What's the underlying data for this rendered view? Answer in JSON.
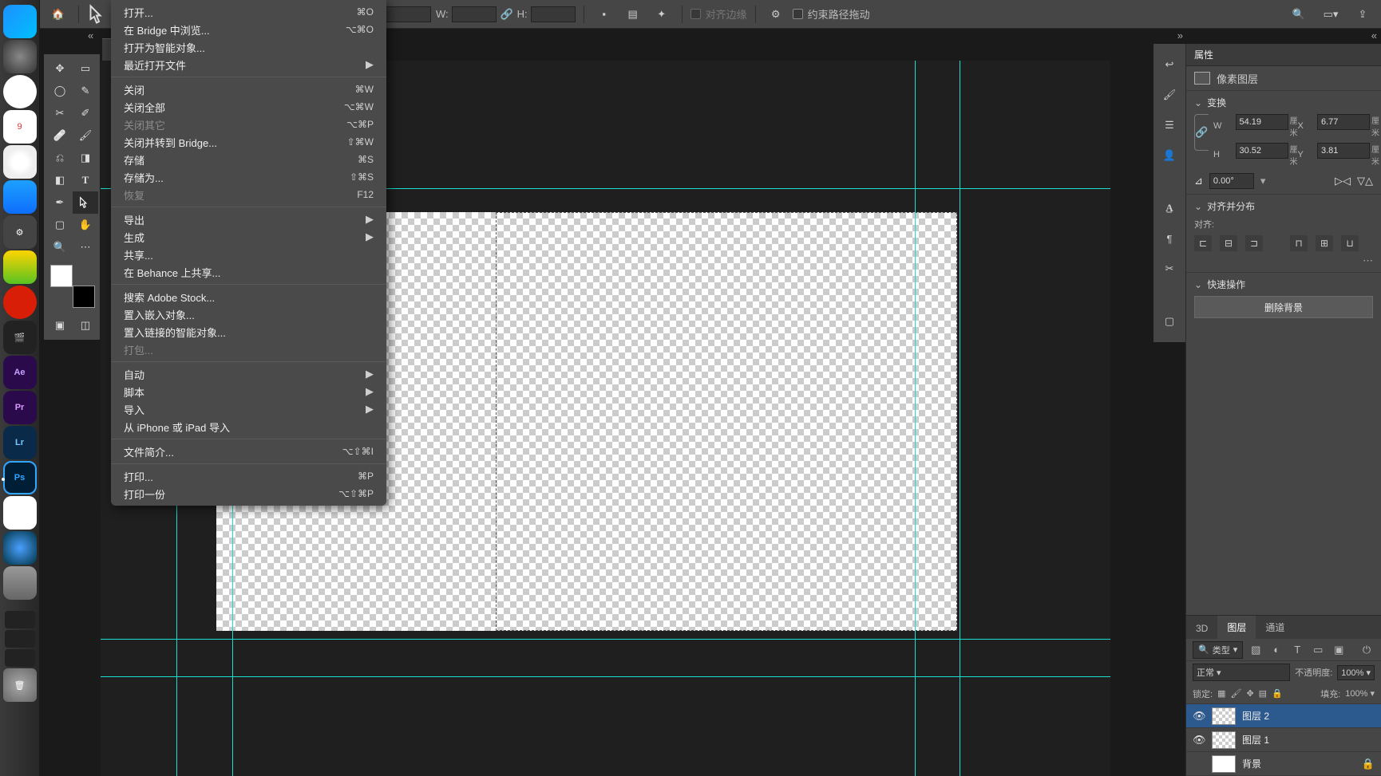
{
  "dock": {
    "items": [
      "finder",
      "launchpad",
      "safari",
      "cal",
      "photos",
      "appstore",
      "settings",
      "music",
      "netease",
      "fcp",
      "ae",
      "pr",
      "lr",
      "ps",
      "youku",
      "qt",
      "cam"
    ],
    "labels": {
      "ae": "Ae",
      "pr": "Pr",
      "lr": "Lr",
      "ps": "Ps",
      "cal": "9"
    }
  },
  "optbar": {
    "w_label": "W:",
    "h_label": "H:",
    "align_edges": "对齐边缘",
    "constrain": "约束路径拖动",
    "search": "🔍"
  },
  "tab_close": "×",
  "props": {
    "panel_title": "属性",
    "layer_type": "像素图层",
    "transform_title": "变换",
    "W": "54.19",
    "W_unit": "厘米",
    "X": "6.77",
    "X_unit": "厘米",
    "H": "30.52",
    "H_unit": "厘米",
    "Y": "3.81",
    "Y_unit": "厘米",
    "angle": "0.00°",
    "align_title": "对齐并分布",
    "align_label": "对齐:",
    "quick_title": "快速操作",
    "remove_bg": "删除背景"
  },
  "layers_panel": {
    "tabs": [
      "3D",
      "图层",
      "通道"
    ],
    "filter_label": "类型",
    "blend": "正常",
    "opacity_label": "不透明度:",
    "opacity": "100%",
    "lock_label": "锁定:",
    "fill_label": "填充:",
    "fill": "100%",
    "layers": [
      {
        "name": "图层 2",
        "visible": true,
        "selected": true,
        "locked": false,
        "thumb": "trans"
      },
      {
        "name": "图层 1",
        "visible": true,
        "selected": false,
        "locked": false,
        "thumb": "trans"
      },
      {
        "name": "背景",
        "visible": false,
        "selected": false,
        "locked": true,
        "thumb": "white"
      }
    ]
  },
  "menu": [
    {
      "label": "打开...",
      "sc": "⌘O"
    },
    {
      "label": "在 Bridge 中浏览...",
      "sc": "⌥⌘O"
    },
    {
      "label": "打开为智能对象..."
    },
    {
      "label": "最近打开文件",
      "arrow": true
    },
    {
      "div": true
    },
    {
      "label": "关闭",
      "sc": "⌘W"
    },
    {
      "label": "关闭全部",
      "sc": "⌥⌘W"
    },
    {
      "label": "关闭其它",
      "sc": "⌥⌘P",
      "disabled": true
    },
    {
      "label": "关闭并转到 Bridge...",
      "sc": "⇧⌘W"
    },
    {
      "label": "存储",
      "sc": "⌘S"
    },
    {
      "label": "存储为...",
      "sc": "⇧⌘S"
    },
    {
      "label": "恢复",
      "sc": "F12",
      "disabled": true
    },
    {
      "div": true
    },
    {
      "label": "导出",
      "arrow": true
    },
    {
      "label": "生成",
      "arrow": true
    },
    {
      "label": "共享..."
    },
    {
      "label": "在 Behance 上共享..."
    },
    {
      "div": true
    },
    {
      "label": "搜索 Adobe Stock..."
    },
    {
      "label": "置入嵌入对象..."
    },
    {
      "label": "置入链接的智能对象..."
    },
    {
      "label": "打包...",
      "disabled": true
    },
    {
      "div": true
    },
    {
      "label": "自动",
      "arrow": true
    },
    {
      "label": "脚本",
      "arrow": true
    },
    {
      "label": "导入",
      "arrow": true
    },
    {
      "label": "从 iPhone 或 iPad 导入"
    },
    {
      "div": true
    },
    {
      "label": "文件简介...",
      "sc": "⌥⇧⌘I"
    },
    {
      "div": true
    },
    {
      "label": "打印...",
      "sc": "⌘P"
    },
    {
      "label": "打印一份",
      "sc": "⌥⇧⌘P"
    }
  ]
}
